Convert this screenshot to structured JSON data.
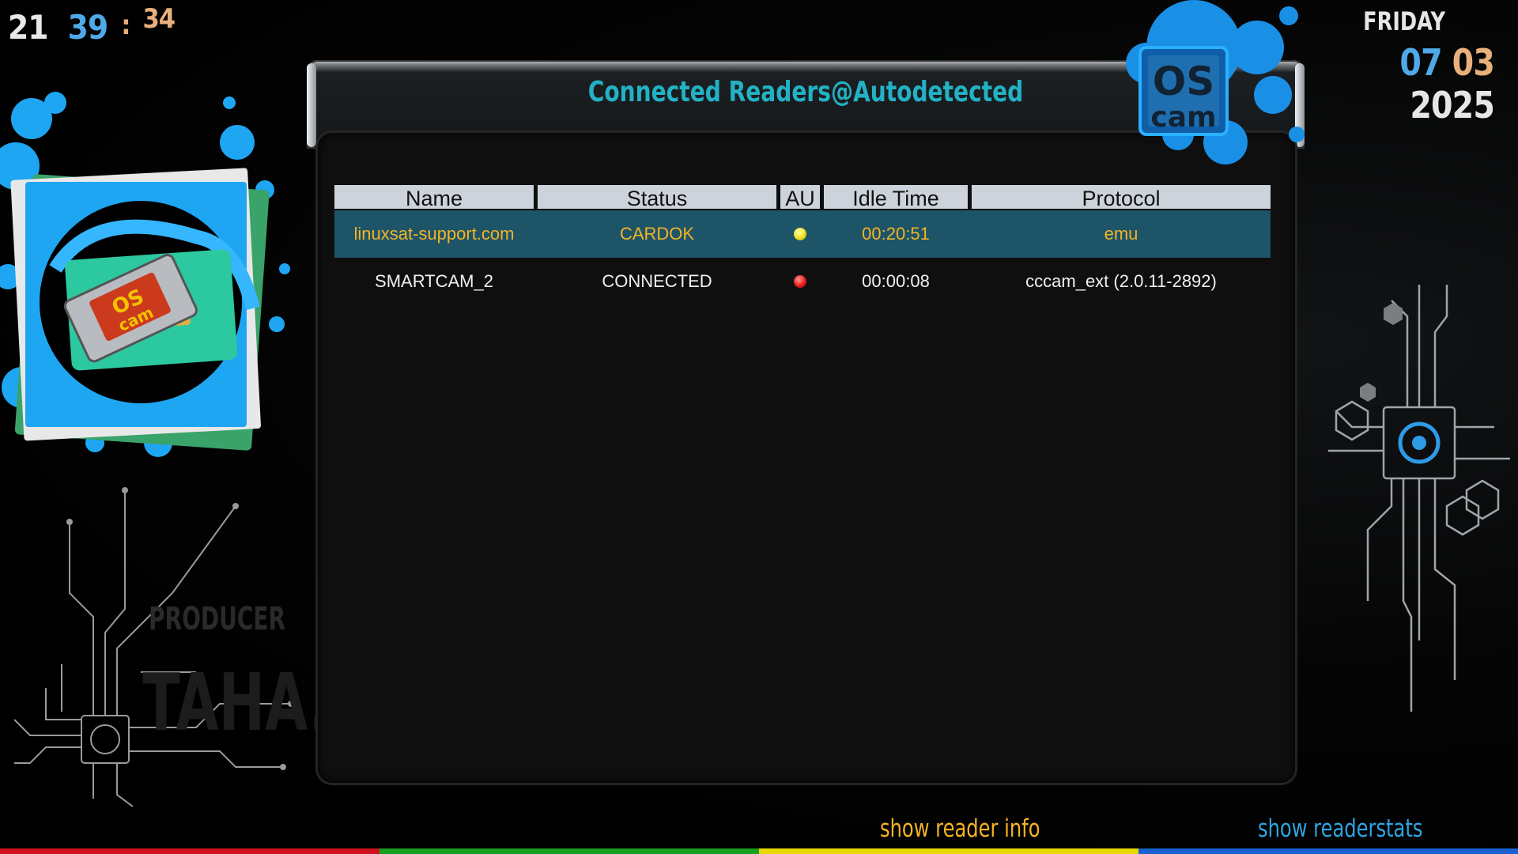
{
  "clock": {
    "hours": "21",
    "minutes": "39",
    "separator": ":",
    "seconds": "34"
  },
  "date": {
    "weekday": "FRIDAY",
    "day": "07",
    "month": "03",
    "year": "2025"
  },
  "panel": {
    "title": "Connected Readers@Autodetected"
  },
  "logo": {
    "text_top": "OS",
    "text_bottom": "cam"
  },
  "table": {
    "headers": [
      "Name",
      "Status",
      "AU",
      "Idle Time",
      "Protocol"
    ],
    "rows": [
      {
        "name": "linuxsat-support.com",
        "status": "CARDOK",
        "au": "yellow",
        "idle": "00:20:51",
        "protocol": "emu",
        "selected": true
      },
      {
        "name": "SMARTCAM_2",
        "status": "CONNECTED",
        "au": "red",
        "idle": "00:00:08",
        "protocol": "cccam_ext (2.0.11-2892)",
        "selected": false
      }
    ]
  },
  "footer": {
    "yellow_label": "show reader info",
    "blue_label": "show readerstats"
  },
  "watermark": {
    "line1": "PRODUCER",
    "line2": "TAHA... K"
  },
  "colors": {
    "accent_cyan": "#22b2c4",
    "selection": "#1d5468",
    "highlight_text": "#f5b324",
    "bar_red": "#d0101a",
    "bar_green": "#18a020",
    "bar_yellow": "#e8d800",
    "bar_blue": "#1a60d0"
  }
}
